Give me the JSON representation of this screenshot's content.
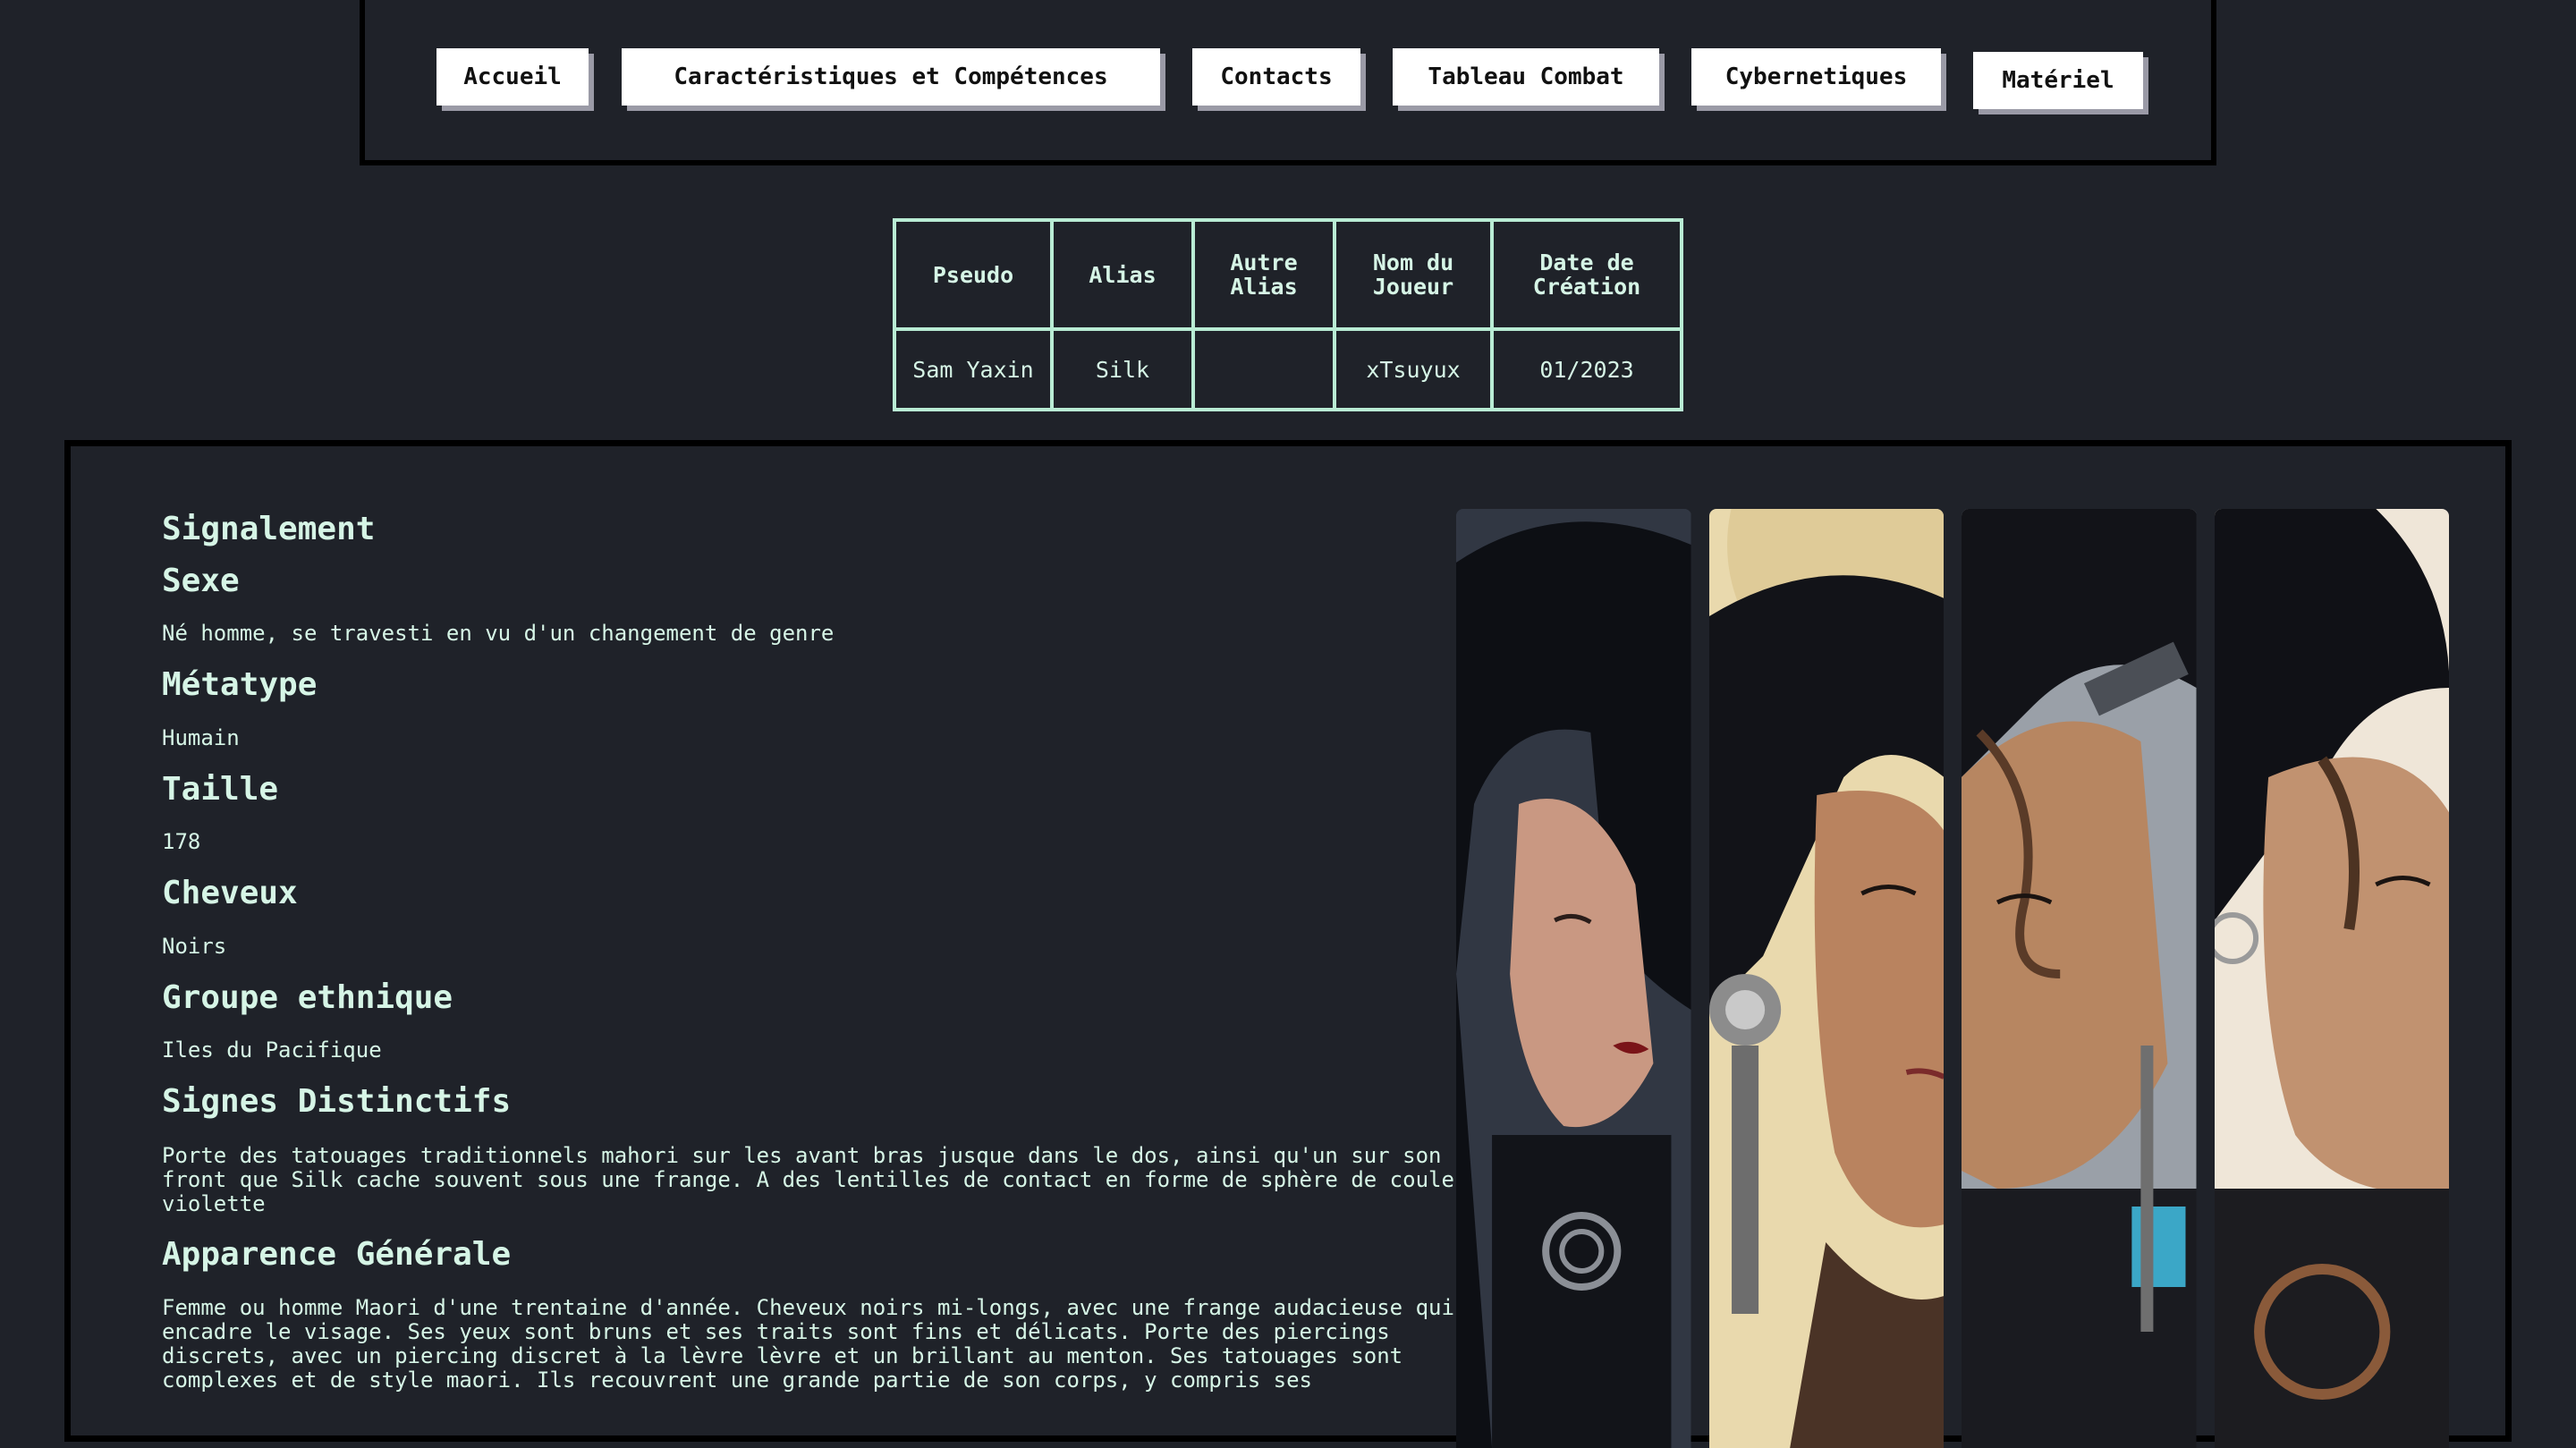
{
  "nav": {
    "items": [
      {
        "label": "Accueil"
      },
      {
        "label": "Caractéristiques et Compétences"
      },
      {
        "label": "Contacts"
      },
      {
        "label": "Tableau Combat"
      },
      {
        "label": "Cybernetiques"
      },
      {
        "label": "Matériel"
      }
    ]
  },
  "identity": {
    "headers": [
      "Pseudo",
      "Alias",
      "Autre Alias",
      "Nom du Joueur",
      "Date de Création"
    ],
    "values": [
      "Sam Yaxin",
      "Silk",
      "",
      "xTsuyux",
      "01/2023"
    ]
  },
  "profile": {
    "section_title": "Signalement",
    "fields": [
      {
        "label": "Sexe",
        "value": "Né homme, se travesti en vu d'un changement de genre"
      },
      {
        "label": "Métatype",
        "value": "Humain"
      },
      {
        "label": "Taille",
        "value": "178"
      },
      {
        "label": "Cheveux",
        "value": "Noirs"
      },
      {
        "label": "Groupe ethnique",
        "value": "Iles du Pacifique"
      },
      {
        "label": "Signes Distinctifs",
        "value": "Porte des tatouages traditionnels mahori sur les avant bras jusque dans le dos, ainsi qu'un sur son front que Silk cache souvent sous une frange. A des lentilles de contact en forme de sphère de couleur violette"
      },
      {
        "label": "Apparence Générale",
        "value": "Femme ou homme Maori d'une trentaine d'année. Cheveux noirs mi-longs, avec une frange audacieuse qui encadre le visage. Ses yeux sont bruns et ses traits sont fins et délicats. Porte des piercings discrets, avec un piercing discret à la lèvre lèvre et un brillant au menton. Ses tatouages sont complexes et de style maori. Ils recouvrent une grande partie de son corps, y compris ses"
      }
    ]
  },
  "portraits": [
    {
      "name": "portrait-1",
      "bg": "#3a4352"
    },
    {
      "name": "portrait-2",
      "bg": "#e9d9ad"
    },
    {
      "name": "portrait-3",
      "bg": "#9aa0a8"
    },
    {
      "name": "portrait-4",
      "bg": "#efe6d8"
    }
  ]
}
